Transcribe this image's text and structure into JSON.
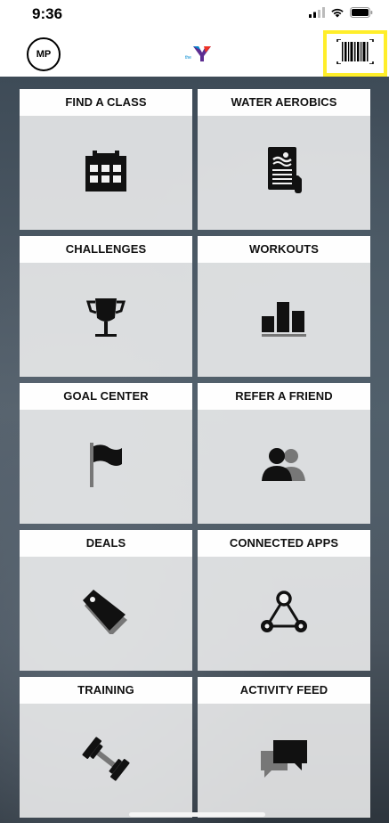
{
  "status_bar": {
    "time": "9:36",
    "icons": [
      "signal-icon",
      "wifi-icon",
      "battery-icon"
    ]
  },
  "header": {
    "avatar_initials": "MP",
    "logo_text": "the",
    "barcode_icon": "barcode-icon",
    "highlight_color": "#ffee2a"
  },
  "tiles": [
    {
      "label": "FIND A CLASS",
      "icon": "calendar-icon"
    },
    {
      "label": "WATER AEROBICS",
      "icon": "swim-document-icon"
    },
    {
      "label": "CHALLENGES",
      "icon": "trophy-icon"
    },
    {
      "label": "WORKOUTS",
      "icon": "bar-chart-icon"
    },
    {
      "label": "GOAL CENTER",
      "icon": "flag-icon"
    },
    {
      "label": "REFER A FRIEND",
      "icon": "people-icon"
    },
    {
      "label": "DEALS",
      "icon": "tag-icon"
    },
    {
      "label": "CONNECTED APPS",
      "icon": "connected-nodes-icon"
    },
    {
      "label": "TRAINING",
      "icon": "dumbbell-icon"
    },
    {
      "label": "ACTIVITY FEED",
      "icon": "chat-bubbles-icon"
    }
  ],
  "colors": {
    "icon": "#111111",
    "tile_bg": "#f2f2f2",
    "logo_purple": "#5c2d91",
    "logo_blue": "#0089d0",
    "logo_red": "#ee3124"
  }
}
